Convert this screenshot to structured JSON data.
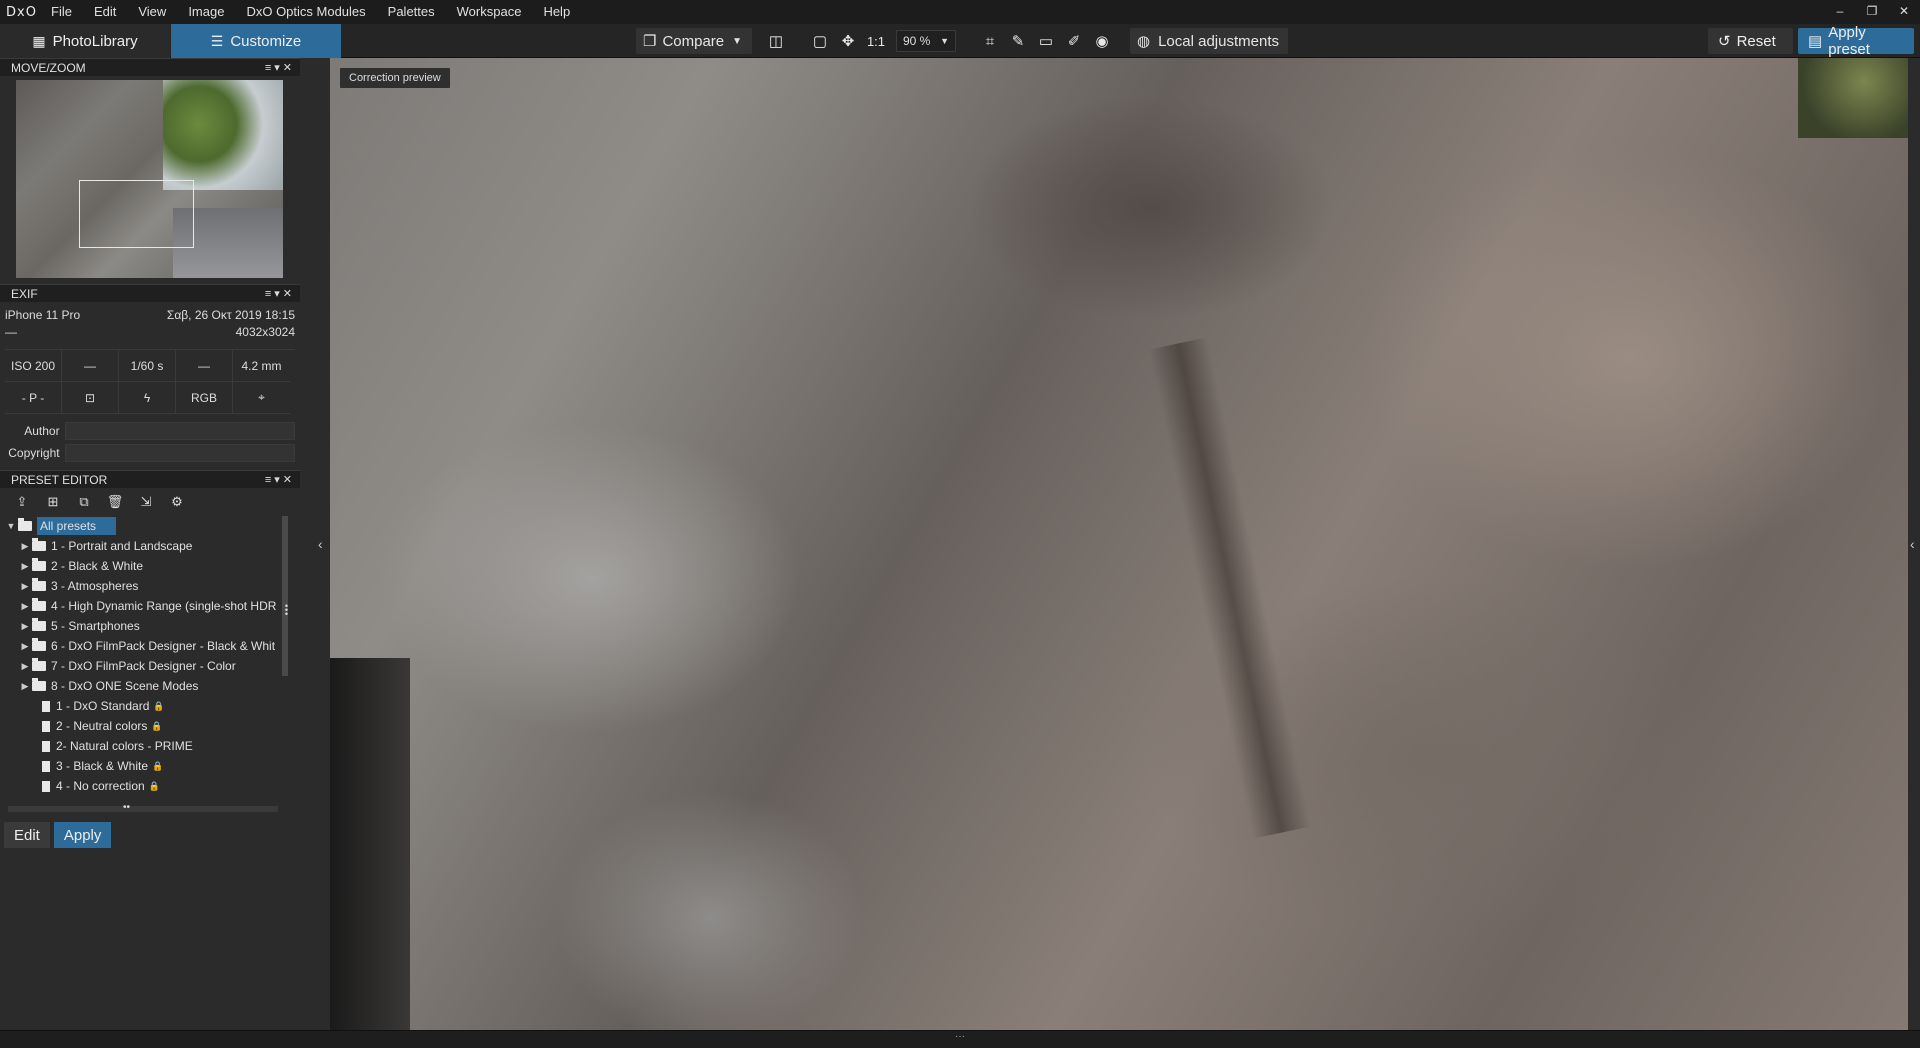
{
  "menubar": {
    "logo": "DxO",
    "items": [
      "File",
      "Edit",
      "View",
      "Image",
      "DxO Optics Modules",
      "Palettes",
      "Workspace",
      "Help"
    ],
    "window_controls": [
      "–",
      "❐",
      "✕"
    ]
  },
  "toolbar": {
    "tab_photolibrary": "PhotoLibrary",
    "tab_customize": "Customize",
    "compare_label": "Compare",
    "ratio_label": "1:1",
    "zoom_value": "90 %",
    "local_adjustments_label": "Local adjustments",
    "reset_label": "Reset",
    "apply_preset_label": "Apply preset"
  },
  "move_zoom": {
    "title": "MOVE/ZOOM"
  },
  "exif": {
    "title": "EXIF",
    "camera": "iPhone 11 Pro",
    "date": "Σαβ, 26 Οκτ 2019 18:15",
    "lens": "—",
    "resolution": "4032x3024",
    "cells": [
      "ISO 200",
      "—",
      "1/60 s",
      "—",
      "4.2 mm",
      "- P -",
      "",
      "",
      "RGB",
      ""
    ],
    "author_label": "Author",
    "copyright_label": "Copyright"
  },
  "preset_editor": {
    "title": "PRESET EDITOR",
    "root": "All presets",
    "folders": [
      "1 - Portrait and Landscape",
      "2 - Black & White",
      "3 - Atmospheres",
      "4 - High Dynamic Range (single-shot HDR",
      "5 - Smartphones",
      "6 - DxO FilmPack Designer - Black & Whit",
      "7 - DxO FilmPack Designer - Color",
      "8 - DxO ONE Scene Modes"
    ],
    "files": [
      {
        "label": "1 - DxO Standard",
        "locked": true
      },
      {
        "label": "2 - Neutral colors",
        "locked": true
      },
      {
        "label": "2- Natural colors - PRIME",
        "locked": false
      },
      {
        "label": "3 - Black & White",
        "locked": true
      },
      {
        "label": "4 - No correction",
        "locked": true
      }
    ],
    "edit_label": "Edit",
    "apply_label": "Apply"
  },
  "viewer": {
    "overlay_label": "Correction preview"
  },
  "colors": {
    "accent": "#2d6b9a",
    "panel": "#2b2b2b",
    "menubar": "#1c1c1c"
  }
}
